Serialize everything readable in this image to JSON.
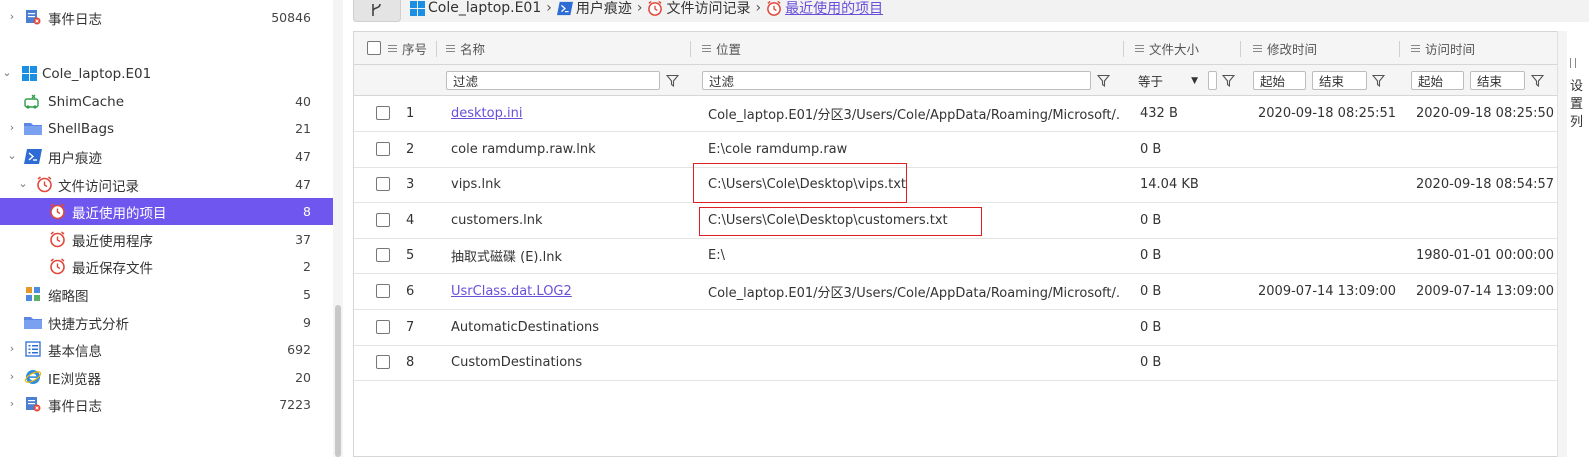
{
  "sidebar": {
    "items": [
      {
        "label": "事件日志",
        "count": "50846",
        "icon": "event-log-icon",
        "caret": "›"
      },
      {
        "label": "Cole_laptop.E01",
        "count": "",
        "icon": "windows-logo-icon",
        "caret": "⌄"
      },
      {
        "label": "ShimCache",
        "count": "40",
        "icon": "shimcache-icon",
        "caret": ""
      },
      {
        "label": "ShellBags",
        "count": "21",
        "icon": "folder-icon",
        "caret": "›"
      },
      {
        "label": "用户痕迹",
        "count": "47",
        "icon": "powershell-icon",
        "caret": "⌄"
      },
      {
        "label": "文件访问记录",
        "count": "47",
        "icon": "clock-icon",
        "caret": "⌄"
      },
      {
        "label": "最近使用的项目",
        "count": "8",
        "icon": "clock-icon",
        "caret": ""
      },
      {
        "label": "最近使用程序",
        "count": "37",
        "icon": "clock-icon",
        "caret": ""
      },
      {
        "label": "最近保存文件",
        "count": "2",
        "icon": "clock-icon",
        "caret": ""
      },
      {
        "label": "缩略图",
        "count": "5",
        "icon": "thumbnail-icon",
        "caret": ""
      },
      {
        "label": "快捷方式分析",
        "count": "9",
        "icon": "folder-icon",
        "caret": ""
      },
      {
        "label": "基本信息",
        "count": "692",
        "icon": "list-icon",
        "caret": "›"
      },
      {
        "label": "IE浏览器",
        "count": "20",
        "icon": "ie-icon",
        "caret": "›"
      },
      {
        "label": "事件日志",
        "count": "7223",
        "icon": "event-log-icon",
        "caret": "›"
      }
    ]
  },
  "breadcrumb": {
    "items": [
      {
        "label": "Cole_laptop.E01",
        "icon": "windows-logo-icon"
      },
      {
        "label": "用户痕迹",
        "icon": "powershell-icon"
      },
      {
        "label": "文件访问记录",
        "icon": "clock-icon"
      },
      {
        "label": "最近使用的项目",
        "icon": "clock-icon"
      }
    ],
    "separator": "›"
  },
  "grid": {
    "columns": {
      "index": "序号",
      "name": "名称",
      "location": "位置",
      "size": "文件大小",
      "modified": "修改时间",
      "accessed": "访问时间"
    },
    "filters": {
      "name_placeholder": "过滤",
      "location_placeholder": "过滤",
      "size_operator": "等于",
      "modified_start": "起始",
      "modified_end": "结束",
      "accessed_start": "起始",
      "accessed_end": "结束"
    },
    "rows": [
      {
        "index": "1",
        "name": "desktop.ini",
        "location": "Cole_laptop.E01/分区3/Users/Cole/AppData/Roaming/Microsoft/...",
        "size": "432 B",
        "modified": "2020-09-18 08:25:51",
        "accessed": "2020-09-18 08:25:50",
        "link": true
      },
      {
        "index": "2",
        "name": "cole ramdump.raw.lnk",
        "location": "E:\\cole ramdump.raw",
        "size": "0 B",
        "modified": "",
        "accessed": "",
        "link": false
      },
      {
        "index": "3",
        "name": "vips.lnk",
        "location": "C:\\Users\\Cole\\Desktop\\vips.txt",
        "size": "14.04 KB",
        "modified": "",
        "accessed": "2020-09-18 08:54:57",
        "link": false
      },
      {
        "index": "4",
        "name": "customers.lnk",
        "location": "C:\\Users\\Cole\\Desktop\\customers.txt",
        "size": "0 B",
        "modified": "",
        "accessed": "",
        "link": false
      },
      {
        "index": "5",
        "name": "抽取式磁碟 (E).lnk",
        "location": "E:\\",
        "size": "0 B",
        "modified": "",
        "accessed": "1980-01-01 00:00:00",
        "link": false
      },
      {
        "index": "6",
        "name": "UsrClass.dat.LOG2",
        "location": "Cole_laptop.E01/分区3/Users/Cole/AppData/Roaming/Microsoft/...",
        "size": "0 B",
        "modified": "2009-07-14 13:09:00",
        "accessed": "2009-07-14 13:09:00",
        "link": true
      },
      {
        "index": "7",
        "name": "AutomaticDestinations",
        "location": "",
        "size": "0 B",
        "modified": "",
        "accessed": "",
        "link": false
      },
      {
        "index": "8",
        "name": "CustomDestinations",
        "location": "",
        "size": "0 B",
        "modified": "",
        "accessed": "",
        "link": false
      }
    ]
  },
  "right_panel": {
    "chars": [
      "设",
      "置",
      "列"
    ]
  },
  "colors": {
    "selected_bg": "#6f56ee",
    "link": "#6a4fd9",
    "highlight_border": "#e02020"
  }
}
